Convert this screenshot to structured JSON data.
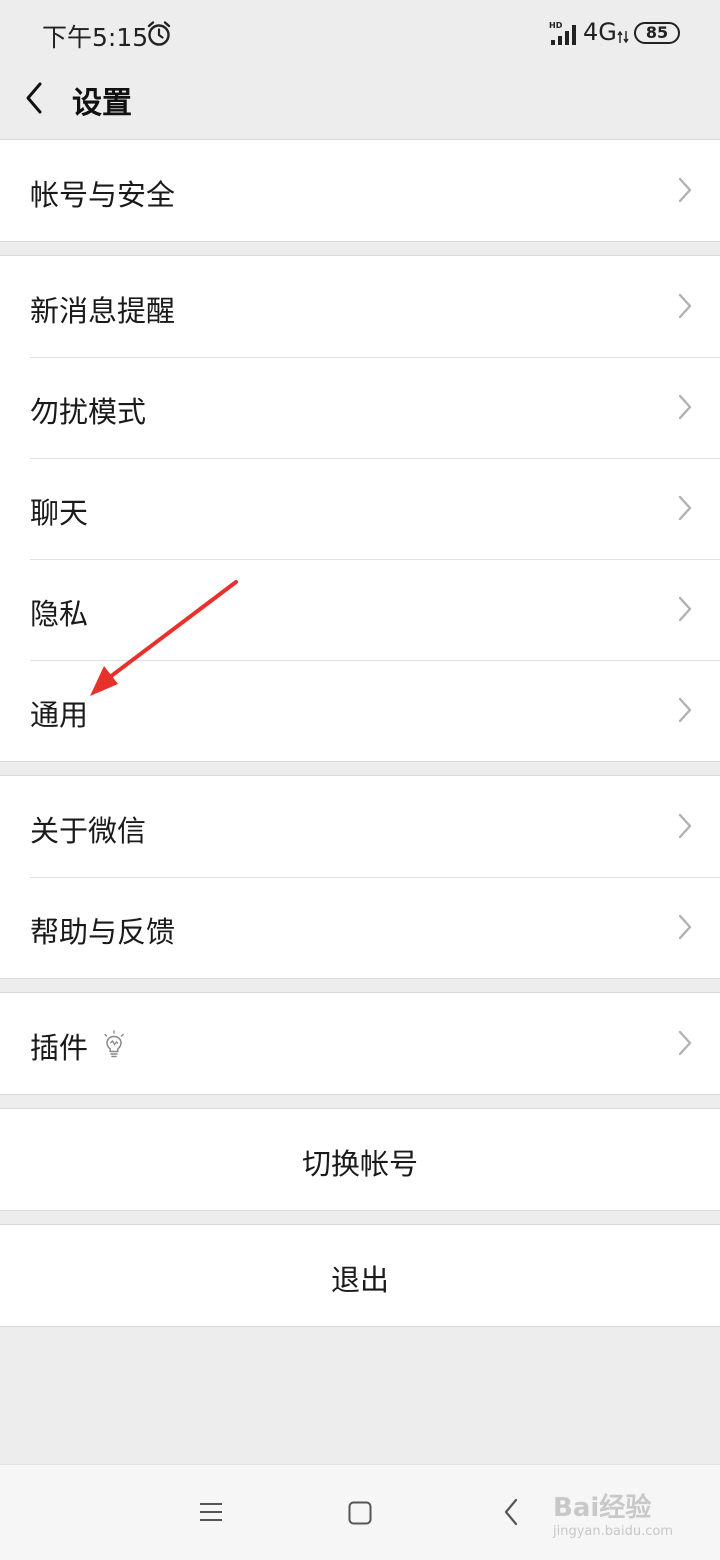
{
  "status_bar": {
    "time": "下午5:15",
    "icons": [
      "alarm-icon",
      "signal-icon",
      "data-arrows-icon"
    ],
    "hd_label": "HD",
    "network": "4G",
    "battery": "85"
  },
  "nav": {
    "title": "设置",
    "back_icon": "chevron-left-icon"
  },
  "groups": {
    "account": {
      "items": [
        {
          "label": "帐号与安全"
        }
      ]
    },
    "main": {
      "items": [
        {
          "label": "新消息提醒"
        },
        {
          "label": "勿扰模式"
        },
        {
          "label": "聊天"
        },
        {
          "label": "隐私"
        },
        {
          "label": "通用"
        }
      ]
    },
    "about": {
      "items": [
        {
          "label": "关于微信"
        },
        {
          "label": "帮助与反馈"
        }
      ]
    },
    "plugins": {
      "items": [
        {
          "label": "插件",
          "badge_icon": "lightbulb-icon"
        }
      ]
    }
  },
  "actions": {
    "switch_account": "切换帐号",
    "logout": "退出"
  },
  "annotation": {
    "arrow_color": "#e8312a",
    "points_to": "通用"
  },
  "system_nav": {
    "icons": [
      "menu-icon",
      "home-icon",
      "back-icon"
    ]
  },
  "watermark": {
    "brand": "Bai经验",
    "url": "jingyan.baidu.com"
  },
  "colors": {
    "background": "#ededed",
    "card": "#ffffff",
    "text": "#1a1a1a",
    "chevron": "#b2b2b2"
  }
}
